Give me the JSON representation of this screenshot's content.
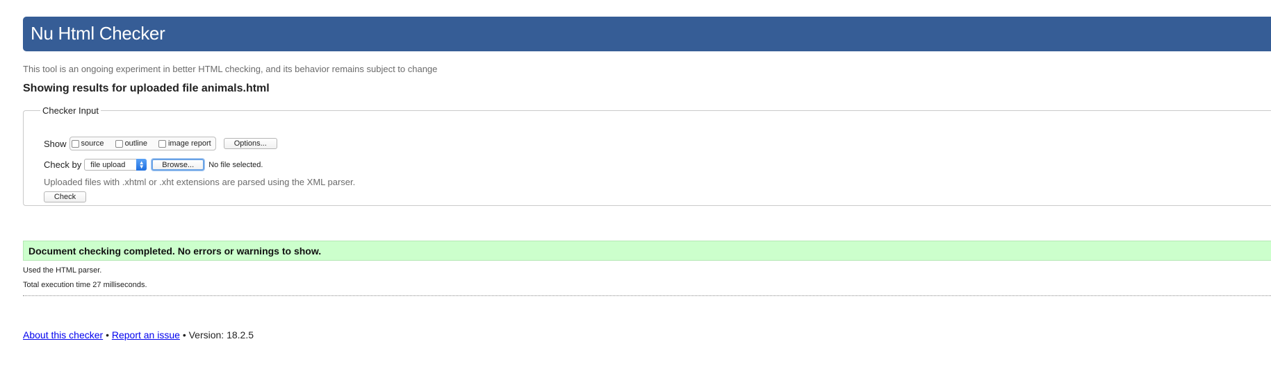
{
  "header": {
    "title": "Nu Html Checker",
    "background_color": "#365d96"
  },
  "subtitle": "This tool is an ongoing experiment in better HTML checking, and its behavior remains subject to change",
  "results_heading": "Showing results for uploaded file animals.html",
  "checker_input": {
    "legend": "Checker Input",
    "show_label": "Show",
    "show_options": [
      {
        "label": "source",
        "checked": false
      },
      {
        "label": "outline",
        "checked": false
      },
      {
        "label": "image report",
        "checked": false
      }
    ],
    "options_button": "Options...",
    "check_by_label": "Check by",
    "check_by_value": "file upload",
    "browse_button": "Browse...",
    "file_status": "No file selected.",
    "xml_note": "Uploaded files with .xhtml or .xht extensions are parsed using the XML parser.",
    "check_button": "Check"
  },
  "result": {
    "message": "Document checking completed. No errors or warnings to show.",
    "color": "#ccffcc",
    "parser_info": "Used the HTML parser.",
    "execution_time": "Total execution time 27 milliseconds."
  },
  "footer": {
    "about_link": "About this checker",
    "separator": "•",
    "report_link": "Report an issue",
    "version": "Version: 18.2.5"
  }
}
